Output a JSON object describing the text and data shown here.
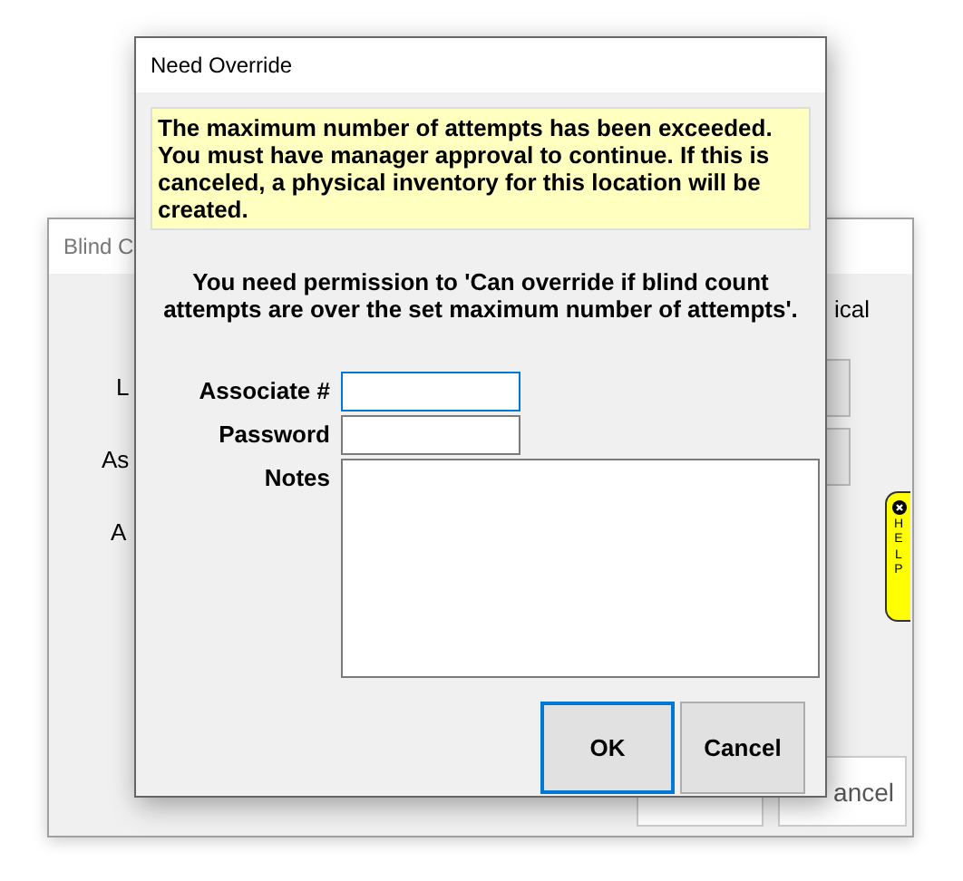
{
  "background_window": {
    "title": "Blind C",
    "labels": [
      "L",
      "As",
      "A"
    ],
    "side_text": "ical",
    "buttons": [
      "ancel"
    ],
    "help_tab": "HELP"
  },
  "dialog": {
    "title": "Need Override",
    "warning": "The maximum number of attempts has been exceeded. You must have manager approval to continue. If this is canceled, a physical inventory for this location will be created.",
    "permission": "You need permission to 'Can override if blind count attempts are over the set maximum number of attempts'.",
    "fields": [
      {
        "label": "Associate #",
        "kind": "input",
        "focused": true
      },
      {
        "label": "Password",
        "kind": "input",
        "focused": false
      },
      {
        "label": "Notes",
        "kind": "textarea",
        "focused": false
      }
    ],
    "buttons": [
      {
        "label": "OK",
        "selected": true
      },
      {
        "label": "Cancel",
        "selected": false
      }
    ]
  }
}
